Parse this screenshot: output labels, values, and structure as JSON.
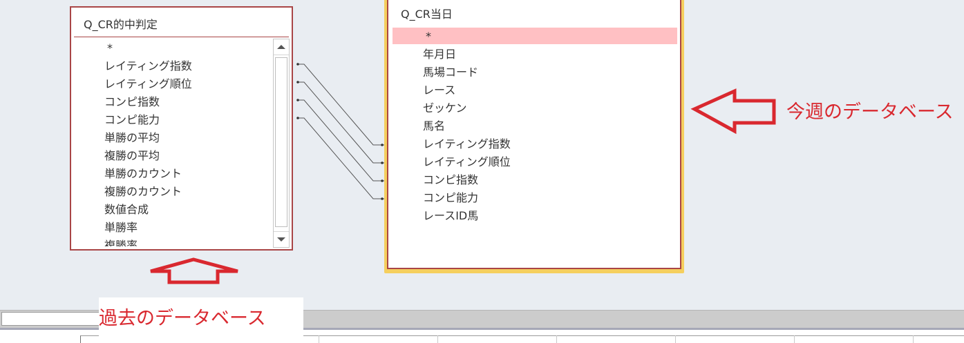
{
  "left_table": {
    "title": "Q_CR的中判定",
    "fields": [
      "*",
      "レイティング指数",
      "レイティング順位",
      "コンピ指数",
      "コンピ能力",
      "単勝の平均",
      "複勝の平均",
      "単勝のカウント",
      "複勝のカウント",
      "数値合成",
      "単勝率",
      "複勝率"
    ]
  },
  "right_table": {
    "title": "Q_CR当日",
    "fields": [
      "*",
      "年月日",
      "馬場コード",
      "レース",
      "ゼッケン",
      "馬名",
      "レイティング指数",
      "レイティング順位",
      "コンピ指数",
      "コンピ能力",
      "レースID馬"
    ],
    "selected_field": "*"
  },
  "annotations": {
    "right_label": "今週のデータベース",
    "left_label": "過去のデータベース",
    "arrow_color": "#d9282f"
  },
  "colors": {
    "table_border": "#a94546",
    "selected_table_highlight": "#f5cf5e",
    "selected_row": "#ffc0c3",
    "canvas_bg": "#e9edf2"
  },
  "icons": {
    "scroll_up": "triangle-up-icon",
    "scroll_down": "triangle-down-icon"
  }
}
